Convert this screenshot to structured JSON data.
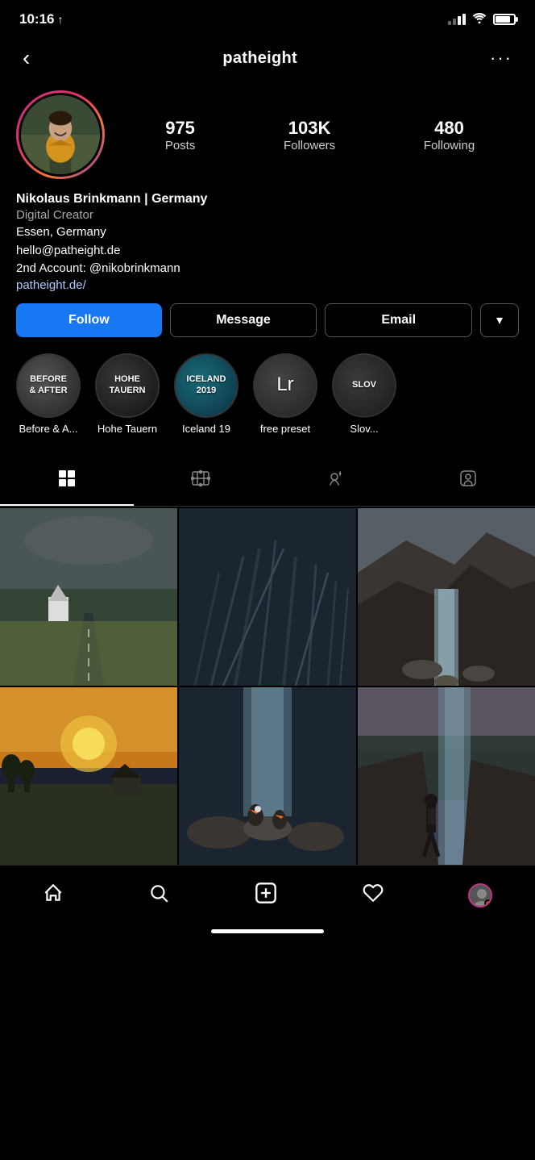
{
  "statusBar": {
    "time": "10:16",
    "arrow": "↑"
  },
  "header": {
    "backLabel": "‹",
    "username": "patheight",
    "moreLabel": "···"
  },
  "profile": {
    "stats": {
      "posts": {
        "number": "975",
        "label": "Posts"
      },
      "followers": {
        "number": "103K",
        "label": "Followers"
      },
      "following": {
        "number": "480",
        "label": "Following"
      }
    },
    "name": "Nikolaus Brinkmann | Germany",
    "category": "Digital Creator",
    "location": "Essen, Germany",
    "email": "hello@patheight.de",
    "secondAccount": "2nd Account: @nikobrinkmann",
    "link": "patheight.de/"
  },
  "buttons": {
    "follow": "Follow",
    "message": "Message",
    "email": "Email",
    "dropdownArrow": "▾"
  },
  "highlights": [
    {
      "id": "before-after",
      "overlayText": "BEFORE\n& AFTER",
      "label": "Before & A..."
    },
    {
      "id": "hohe",
      "overlayText": "HOHE\nTAUERN",
      "label": "Hohe Tauern"
    },
    {
      "id": "iceland",
      "overlayText": "ICELAND\n2019",
      "label": "Iceland 19"
    },
    {
      "id": "lr",
      "overlayText": "Lr",
      "label": "free preset"
    },
    {
      "id": "slove",
      "overlayText": "SLOV",
      "label": "Slov..."
    }
  ],
  "tabs": [
    {
      "id": "grid",
      "icon": "⊞",
      "label": "grid",
      "active": true
    },
    {
      "id": "reels",
      "icon": "📺",
      "label": "reels",
      "active": false
    },
    {
      "id": "collab",
      "icon": "☺",
      "label": "collab",
      "active": false
    },
    {
      "id": "tagged",
      "icon": "👤",
      "label": "tagged",
      "active": false
    }
  ],
  "photos": [
    {
      "id": "photo1",
      "scene": "scene1"
    },
    {
      "id": "photo2",
      "scene": "scene2"
    },
    {
      "id": "photo3",
      "scene": "scene3"
    },
    {
      "id": "photo4",
      "scene": "scene4"
    },
    {
      "id": "photo5",
      "scene": "scene5"
    },
    {
      "id": "photo6",
      "scene": "scene6"
    }
  ],
  "bottomNav": [
    {
      "id": "home",
      "icon": "🏠"
    },
    {
      "id": "search",
      "icon": "🔍"
    },
    {
      "id": "add",
      "icon": "⊞"
    },
    {
      "id": "heart",
      "icon": "♡"
    },
    {
      "id": "profile",
      "icon": "avatar"
    }
  ]
}
